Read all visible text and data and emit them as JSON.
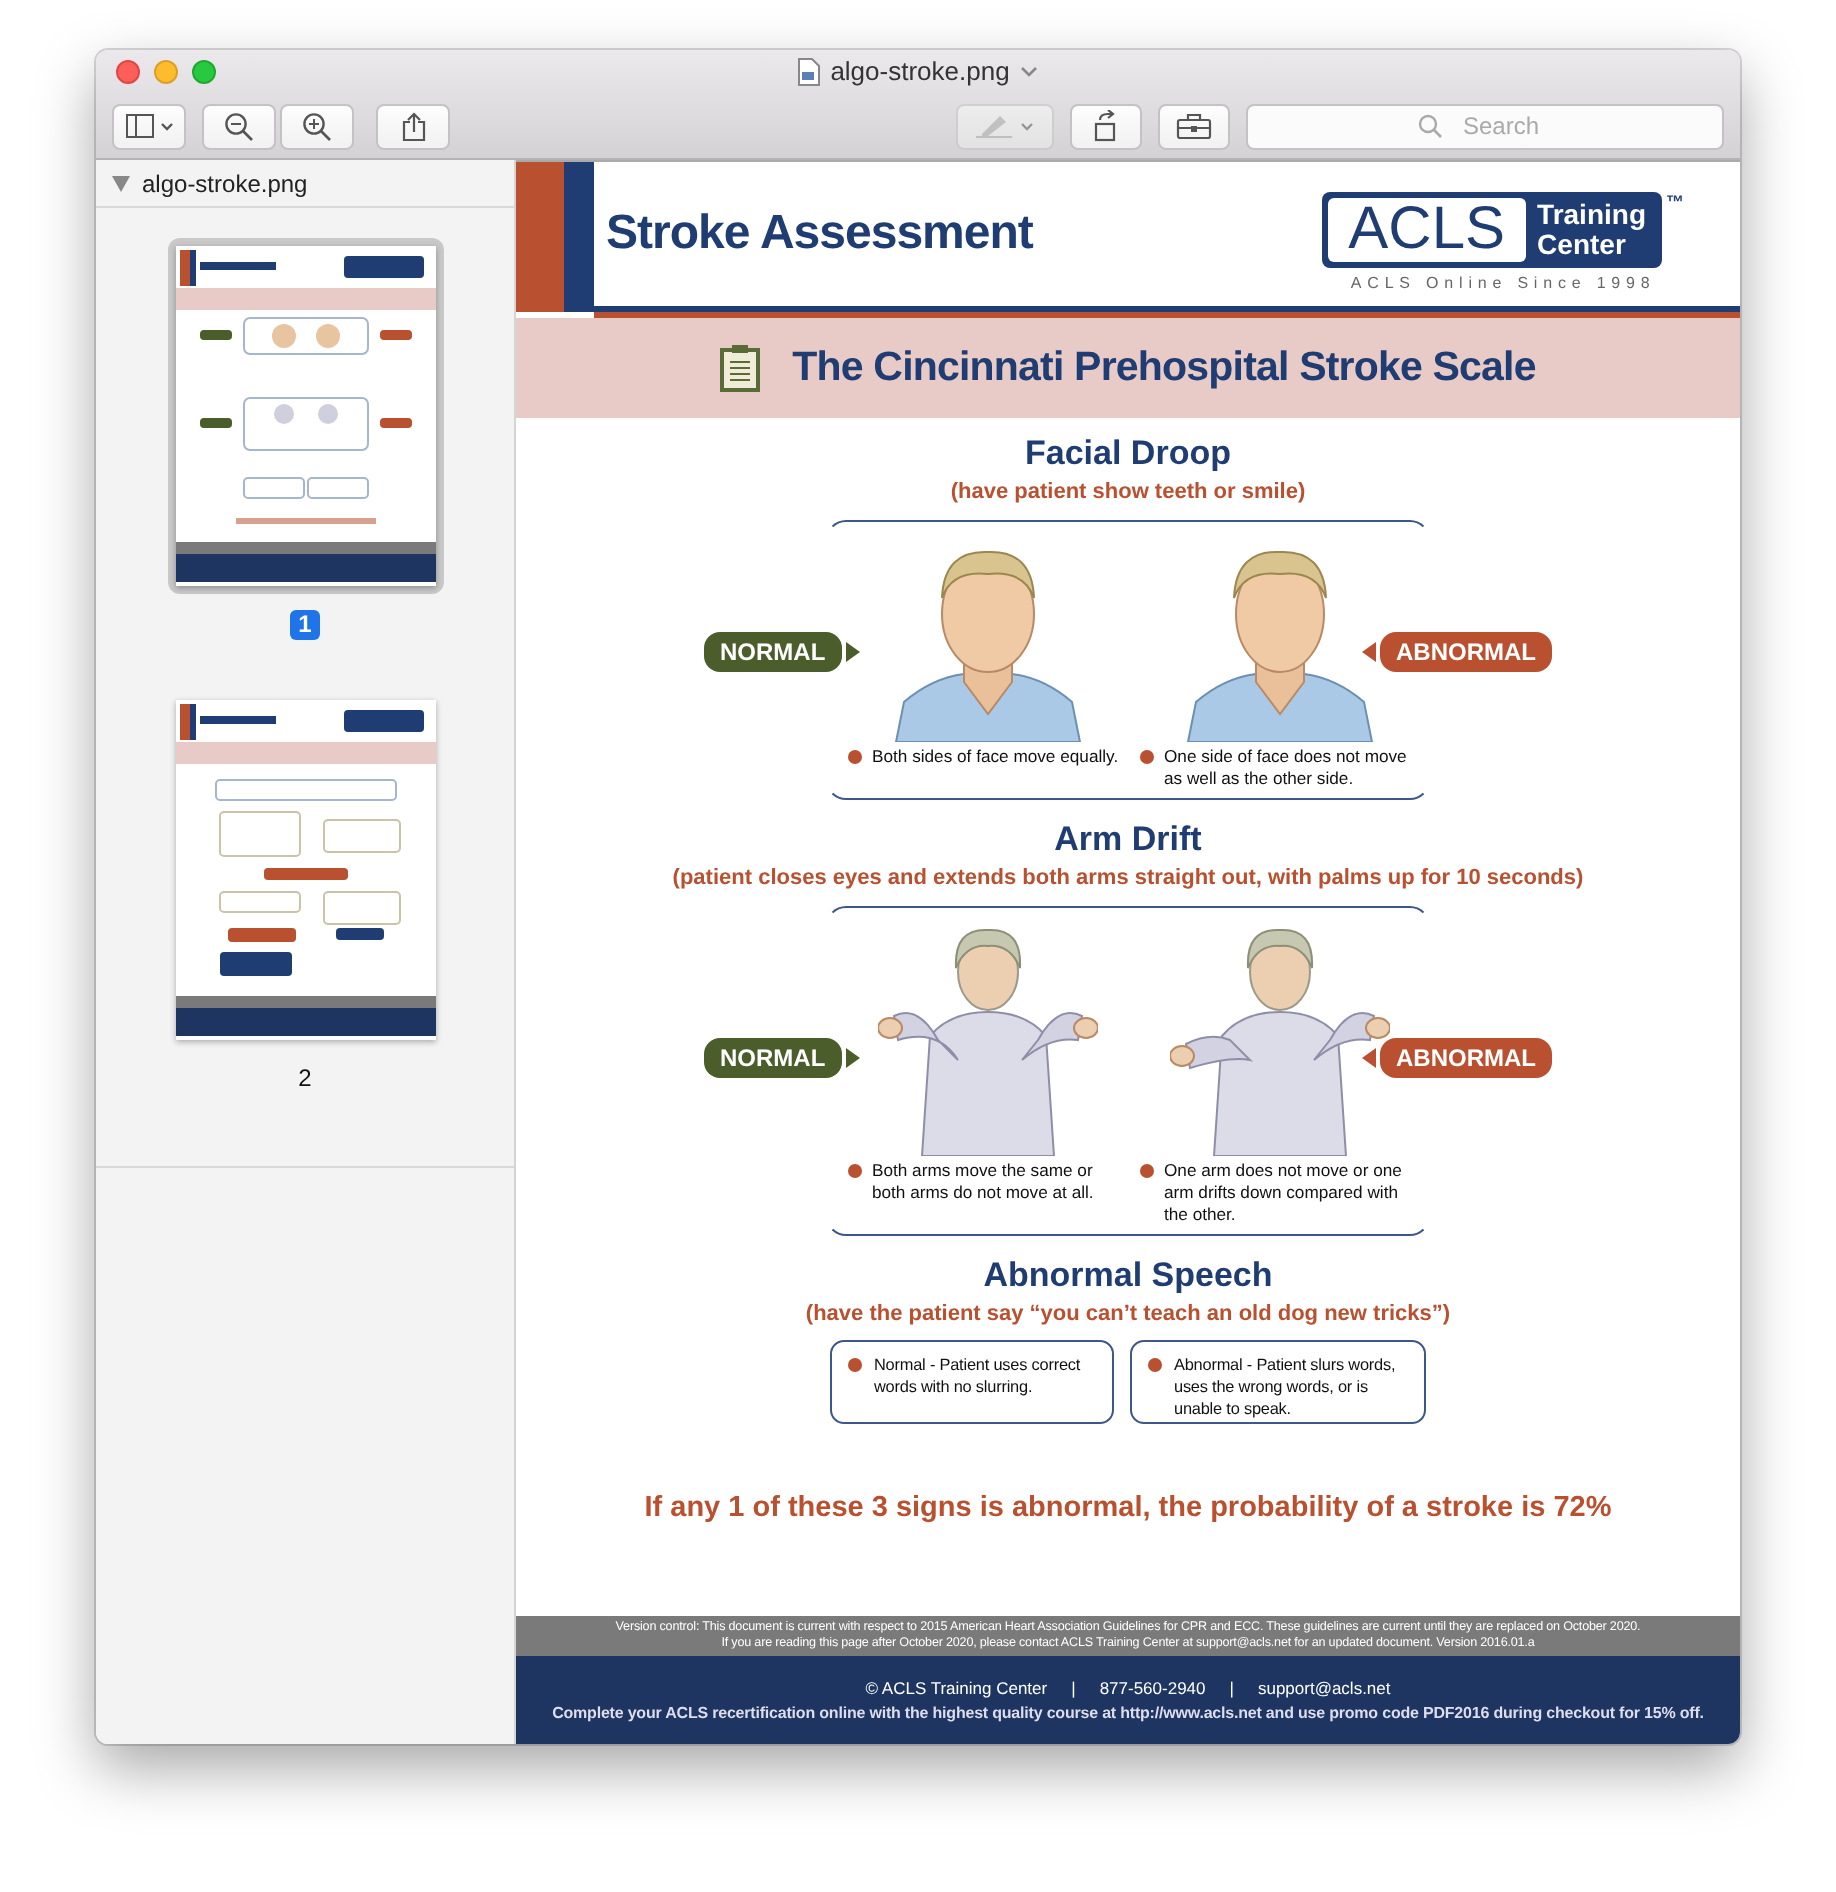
{
  "window": {
    "title": "algo-stroke.png"
  },
  "toolbar": {
    "search": {
      "placeholder": "Search"
    }
  },
  "sidebar": {
    "file": "algo-stroke.png",
    "expanded": true,
    "pages": [
      {
        "number": "1",
        "selected": true
      },
      {
        "number": "2",
        "selected": false
      }
    ]
  },
  "document": {
    "header": {
      "title": "Stroke Assessment",
      "logo": {
        "main": "ACLS",
        "side": [
          "Training",
          "Center"
        ],
        "tm": "™",
        "tagline": "ACLS Online Since 1998"
      }
    },
    "banner": "The Cincinnati Prehospital Stroke Scale",
    "sections": [
      {
        "kind": "face",
        "title": "Facial Droop",
        "instruction": "(have patient show teeth or smile)",
        "labels": [
          "NORMAL",
          "ABNORMAL"
        ],
        "notes": [
          "Both sides of face move equally.",
          "One side of face does not move as well as the other side."
        ]
      },
      {
        "kind": "arms",
        "title": "Arm Drift",
        "instruction": "(patient closes eyes and extends both arms straight out, with palms up for 10 seconds)",
        "labels": [
          "NORMAL",
          "ABNORMAL"
        ],
        "notes": [
          "Both arms move the same or both arms do not move at all.",
          "One arm does not move or one arm drifts down compared with the other."
        ]
      },
      {
        "kind": "speech",
        "title": "Abnormal Speech",
        "instruction": "(have the patient say “you can’t teach an old dog new tricks”)",
        "notes": [
          "Normal - Patient uses correct words with no slurring.",
          "Abnormal - Patient slurs words, uses the wrong words, or is unable to speak."
        ]
      }
    ],
    "conclusion": "If any 1 of these 3 signs is abnormal, the probability of a stroke is 72%",
    "version_note": [
      "Version control: This document is current with respect to 2015 American Heart Association Guidelines for CPR and ECC. These guidelines are current until they are replaced on October 2020.",
      "If you are reading this page after October 2020, please contact ACLS Training Center at support@acls.net for an updated document. Version 2016.01.a"
    ],
    "contact": [
      "© ACLS Training Center",
      "|",
      "877-560-2940",
      "|",
      "support@acls.net"
    ],
    "promo": "Complete your ACLS recertification online with the highest quality course at http://www.acls.net and use promo code PDF2016 during checkout for 15% off."
  }
}
